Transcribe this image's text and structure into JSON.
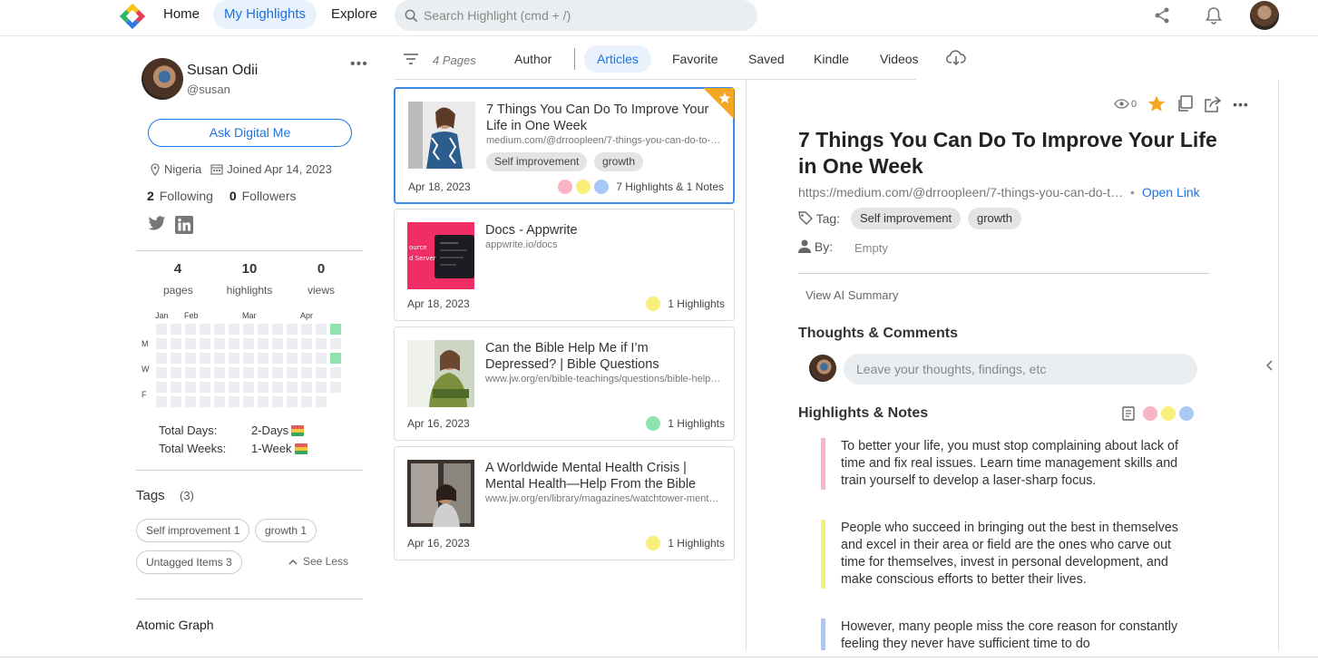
{
  "nav": {
    "home": "Home",
    "my_highlights": "My Highlights",
    "explore": "Explore",
    "search_placeholder": "Search Highlight (cmd + /)"
  },
  "profile": {
    "name": "Susan Odii",
    "handle": "@susan",
    "ask_button": "Ask Digital Me",
    "location": "Nigeria",
    "joined": "Joined Apr 14, 2023",
    "following_count": "2",
    "following_label": "Following",
    "followers_count": "0",
    "followers_label": "Followers"
  },
  "stats": [
    {
      "value": "4",
      "label": "pages"
    },
    {
      "value": "10",
      "label": "highlights"
    },
    {
      "value": "0",
      "label": "views"
    }
  ],
  "heatmap": {
    "months": [
      "Jan",
      "Feb",
      "Mar",
      "Apr"
    ],
    "days": [
      "M",
      "W",
      "F"
    ],
    "total_days_label": "Total Days:",
    "total_days_value": "2-Days",
    "total_weeks_label": "Total Weeks:",
    "total_weeks_value": "1-Week"
  },
  "tags": {
    "title": "Tags",
    "count": "(3)",
    "items": [
      "Self improvement 1",
      "growth 1",
      "Untagged Items 3"
    ],
    "see_less": "See Less"
  },
  "atomic_graph": "Atomic Graph",
  "filters": {
    "pages": "4 Pages",
    "tabs": [
      "Author",
      "Articles",
      "Favorite",
      "Saved",
      "Kindle",
      "Videos"
    ],
    "active_tab": "Articles"
  },
  "articles": [
    {
      "title": "7 Things You Can Do To Improve Your Life in One Week",
      "url": "medium.com/@drroopleen/7-things-you-can-do-to-improve-your-life",
      "tags": [
        "Self improvement",
        "growth"
      ],
      "date": "Apr 18, 2023",
      "summary": "7 Highlights & 1 Notes",
      "colors": [
        "#f8b4c4",
        "#f7ef7a",
        "#a9c8f5"
      ]
    },
    {
      "title": "Docs - Appwrite",
      "url": "appwrite.io/docs",
      "date": "Apr 18, 2023",
      "summary": "1 Highlights",
      "colors": [
        "#f7ef7a"
      ]
    },
    {
      "title": "Can the Bible Help Me if I’m Depressed? | Bible Questions",
      "url": "www.jw.org/en/bible-teachings/questions/bible-help-depression",
      "date": "Apr 16, 2023",
      "summary": "1 Highlights",
      "colors": [
        "#8ee3b0"
      ]
    },
    {
      "title": "A Worldwide Mental Health Crisis | Mental Health—Help From the Bible",
      "url": "www.jw.org/en/library/magazines/watchtower-mental-health",
      "date": "Apr 16, 2023",
      "summary": "1 Highlights",
      "colors": [
        "#f7ef7a"
      ]
    }
  ],
  "detail": {
    "views": "0",
    "title": "7 Things You Can Do To Improve Your Life in One Week",
    "url": "https://medium.com/@drroopleen/7-things-you-can-do-t…",
    "open_link": "Open Link",
    "tag_label": "Tag:",
    "tags": [
      "Self improvement",
      "growth"
    ],
    "by_label": "By:",
    "by_value": "Empty",
    "ai_summary": "View AI Summary",
    "thoughts_title": "Thoughts & Comments",
    "comment_placeholder": "Leave your thoughts, findings, etc",
    "highlights_title": "Highlights & Notes",
    "highlights": [
      {
        "text": "To better your life, you must stop complaining about lack of time and fix real issues. Learn time management skills and train yourself to develop a laser-sharp focus.",
        "color": "#f8b4c4"
      },
      {
        "text": "People who succeed in bringing out the best in themselves and excel in their area or field are the ones who carve out time for themselves, invest in personal development, and make conscious efforts to better their lives.",
        "color": "#f7ef7a"
      },
      {
        "text": "However, many people miss the core reason for constantly feeling they never have sufficient time to do",
        "color": "#a9c8f5"
      }
    ]
  },
  "colors": {
    "accent": "#1a73e8",
    "pink": "#f8b4c4",
    "yellow": "#f7ef7a",
    "blue": "#a9c8f5",
    "green": "#8ee3b0",
    "star": "#f5a623"
  }
}
